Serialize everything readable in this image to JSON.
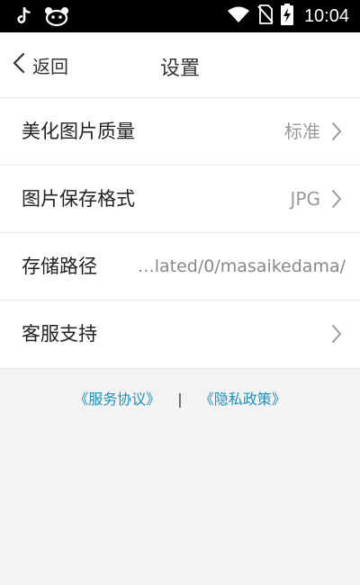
{
  "status_bar": {
    "time": "10:04",
    "icons": [
      "tiktok-icon",
      "panda-app-icon",
      "wifi-icon",
      "no-sim-icon",
      "battery-charging-icon"
    ]
  },
  "nav": {
    "back_label": "返回",
    "title": "设置"
  },
  "settings": {
    "items": [
      {
        "label": "美化图片质量",
        "value": "标准"
      },
      {
        "label": "图片保存格式",
        "value": "JPG"
      },
      {
        "label": "存储路径",
        "value": "…lated/0/masaikedama/"
      },
      {
        "label": "客服支持",
        "value": ""
      }
    ]
  },
  "footer": {
    "service_agreement": "《服务协议》",
    "separator": "|",
    "privacy_policy": "《隐私政策》"
  },
  "colors": {
    "link": "#1f8fc0",
    "status_bar": "#000000",
    "background": "#f3f3f3"
  }
}
